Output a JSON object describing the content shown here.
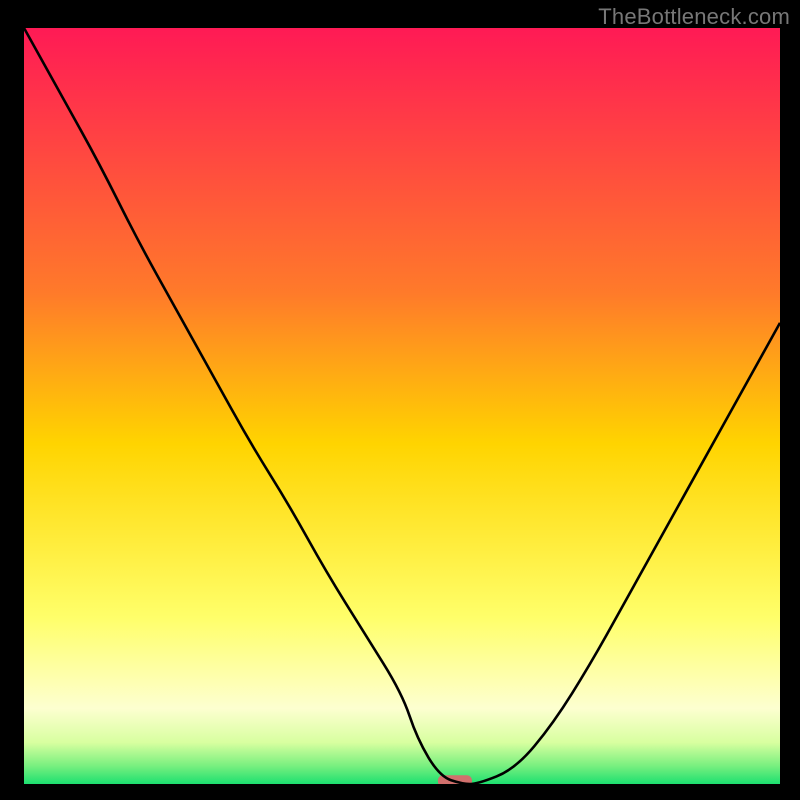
{
  "watermark": {
    "text": "TheBottleneck.com"
  },
  "chart_data": {
    "type": "line",
    "title": "",
    "xlabel": "",
    "ylabel": "",
    "xlim": [
      0,
      100
    ],
    "ylim": [
      0,
      100
    ],
    "x": [
      0,
      5,
      10,
      15,
      20,
      25,
      30,
      35,
      40,
      45,
      50,
      52,
      55,
      58,
      60,
      65,
      70,
      75,
      80,
      85,
      90,
      95,
      100
    ],
    "values": [
      100,
      91,
      82,
      72,
      63,
      54,
      45,
      37,
      28,
      20,
      12,
      6,
      1,
      0,
      0,
      2,
      8,
      16,
      25,
      34,
      43,
      52,
      61
    ],
    "gradient_stops": [
      {
        "offset": 0.0,
        "color": "#ff1a55"
      },
      {
        "offset": 0.35,
        "color": "#ff7a2a"
      },
      {
        "offset": 0.55,
        "color": "#ffd400"
      },
      {
        "offset": 0.78,
        "color": "#ffff6a"
      },
      {
        "offset": 0.9,
        "color": "#fdffd0"
      },
      {
        "offset": 0.945,
        "color": "#d8ffa0"
      },
      {
        "offset": 0.975,
        "color": "#7cf080"
      },
      {
        "offset": 1.0,
        "color": "#1de070"
      }
    ],
    "marker": {
      "x": 57,
      "y": 0.4,
      "w": 4.5,
      "h": 1.5,
      "color": "#d1706d"
    }
  }
}
